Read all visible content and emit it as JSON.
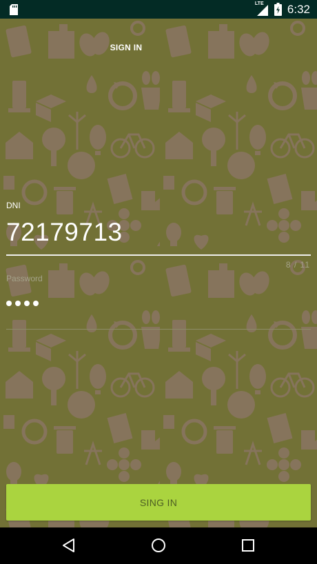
{
  "status_bar": {
    "time": "6:32",
    "network": "LTE",
    "icons": [
      "sd-card-icon",
      "lte-signal-icon",
      "battery-icon"
    ]
  },
  "header": {
    "title": "SIGN IN"
  },
  "form": {
    "dni_label": "DNI",
    "dni_value": "72179713",
    "dni_counter": "8 / 11",
    "password_label": "Password",
    "password_masked_length": 4
  },
  "actions": {
    "sign_in_label": "SING IN"
  },
  "nav_bar": {
    "icons": [
      "back-icon",
      "home-icon",
      "recents-icon"
    ]
  },
  "colors": {
    "status_bar": "#032b25",
    "background": "#727136",
    "pattern": "#8a7462",
    "button": "#aad43f",
    "button_text": "#4d5e23"
  }
}
